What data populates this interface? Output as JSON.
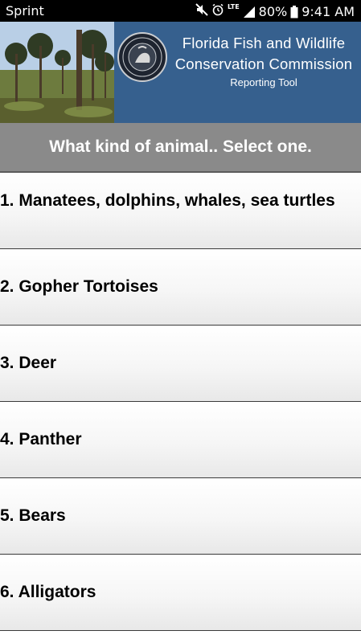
{
  "status_bar": {
    "carrier": "Sprint",
    "lte": "LTE",
    "battery_percent": "80%",
    "time": "9:41 AM",
    "icons": [
      "mute-icon",
      "alarm-icon",
      "lte-signal-icon",
      "battery-icon"
    ]
  },
  "header": {
    "title_line1": "Florida Fish and Wildlife",
    "title_line2": "Conservation Commission",
    "subtitle": "Reporting Tool",
    "background_color": "#36608e",
    "photo": "pine-forest-photo",
    "logo": "fwc-seal-logo"
  },
  "banner": {
    "text": "What kind of animal.. Select one.",
    "background_color": "#8a8a8a"
  },
  "animal_list": {
    "items": [
      {
        "label": "1. Manatees, dolphins, whales, sea turtles"
      },
      {
        "label": "2. Gopher Tortoises"
      },
      {
        "label": "3. Deer"
      },
      {
        "label": "4. Panther"
      },
      {
        "label": "5. Bears"
      },
      {
        "label": "6. Alligators"
      }
    ]
  }
}
